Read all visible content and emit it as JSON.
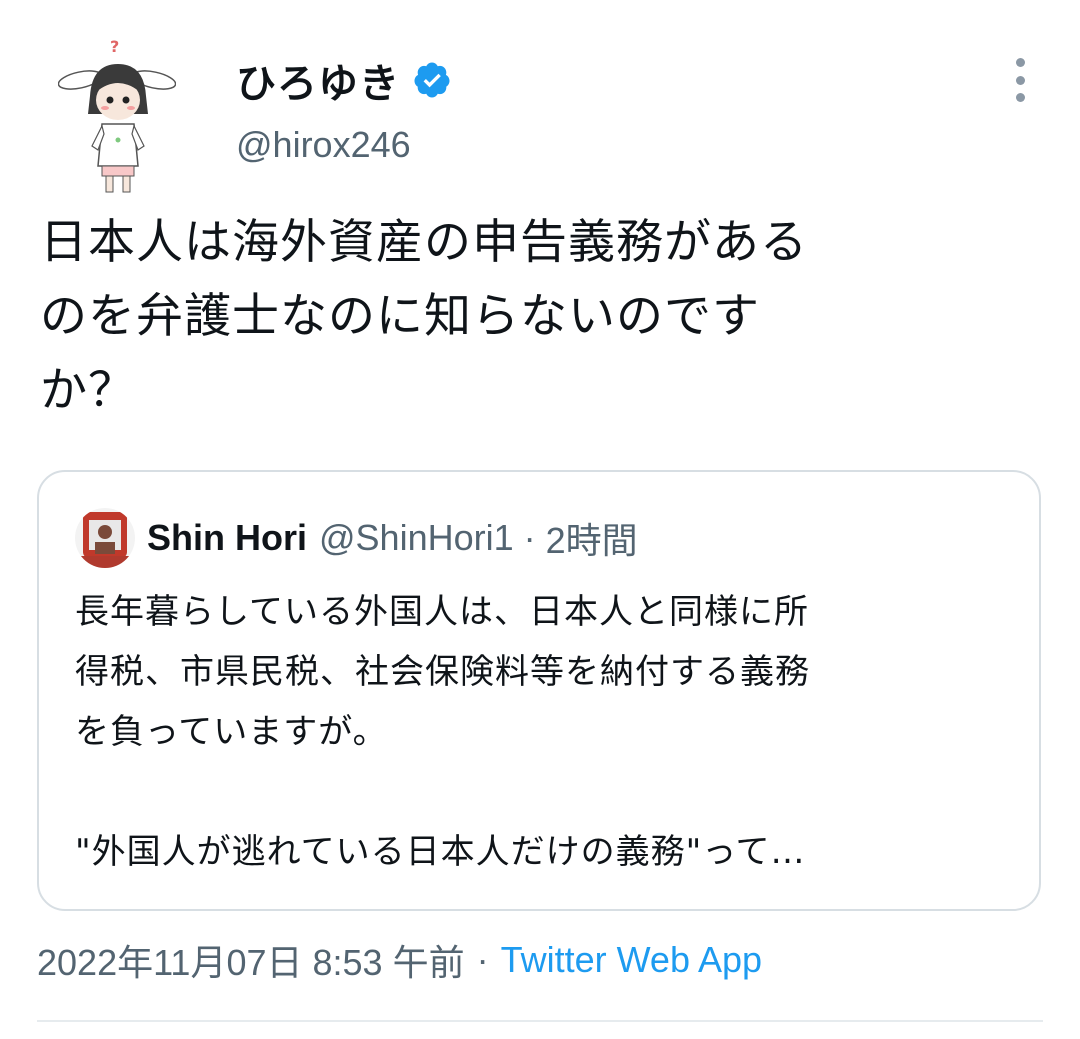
{
  "author": {
    "display_name": "ひろゆき",
    "handle": "@hirox246",
    "verified_icon": "verified-badge-icon",
    "accent_color": "#1d9bf0"
  },
  "tweet": {
    "text": "日本人は海外資産の申告義務がある\nのを弁護士なのに知らないのです\nか？"
  },
  "quoted_tweet": {
    "name": "Shin Hori",
    "handle": "@ShinHori1",
    "separator": "·",
    "time": "2時間",
    "text": "長年暮らしている外国人は、日本人と同様に所\n得税、市県民税、社会保険料等を納付する義務\nを負っていますが。\n\n\"外国人が逃れている日本人だけの義務\"って…"
  },
  "meta": {
    "timestamp": "2022年11月07日 8:53 午前",
    "separator": "·",
    "source": "Twitter Web App"
  },
  "icons": {
    "more": "more-options-icon"
  }
}
